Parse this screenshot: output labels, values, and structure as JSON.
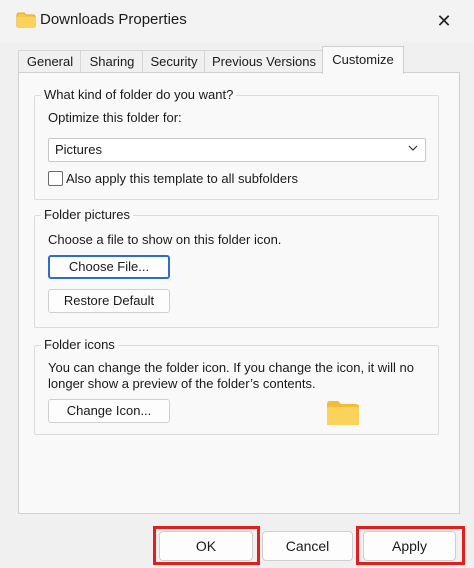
{
  "window": {
    "title": "Downloads Properties",
    "close_glyph": "✕"
  },
  "tabs": [
    {
      "label": "General"
    },
    {
      "label": "Sharing"
    },
    {
      "label": "Security"
    },
    {
      "label": "Previous Versions"
    },
    {
      "label": "Customize",
      "active": true
    }
  ],
  "folder_type": {
    "legend": "What kind of folder do you want?",
    "optimize_label": "Optimize this folder for:",
    "selected": "Pictures",
    "apply_subfolders_label": "Also apply this template to all subfolders",
    "apply_subfolders_checked": false
  },
  "folder_pictures": {
    "legend": "Folder pictures",
    "description": "Choose a file to show on this folder icon.",
    "choose_file_label": "Choose File...",
    "restore_default_label": "Restore Default"
  },
  "folder_icons": {
    "legend": "Folder icons",
    "description_line1": "You can change the folder icon. If you change the icon, it will no",
    "description_line2": "longer show a preview of the folder’s contents.",
    "change_icon_label": "Change Icon..."
  },
  "footer": {
    "ok_label": "OK",
    "cancel_label": "Cancel",
    "apply_label": "Apply"
  },
  "colors": {
    "highlight": "#e02020",
    "focus_border": "#2b6ccf",
    "folder": "#f7c94b"
  }
}
